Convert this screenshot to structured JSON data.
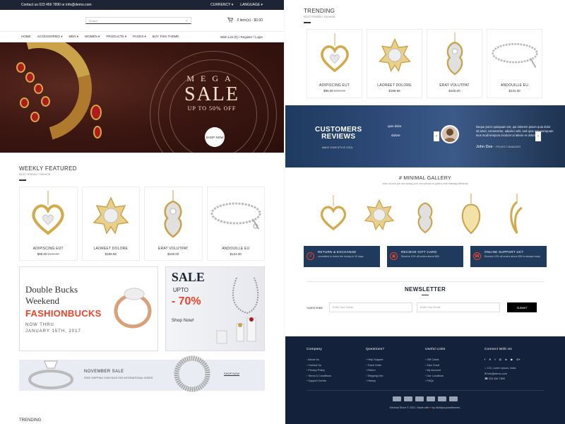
{
  "topbar": {
    "contact": "Contact us 023 456 7890 or info@demo.com",
    "currency": "CURRENCY",
    "language": "LANGUAGE"
  },
  "header": {
    "search_placeholder": "Search",
    "cart": "0 item(s) - $0.00"
  },
  "nav": {
    "items": [
      "HOME",
      "ACCESSORIES ▾",
      "MEN ▾",
      "WOMEN ▾",
      "PRODUCTS ▾",
      "PAGES ▾",
      "BUY THIS THEME"
    ],
    "right": "Wish List (0) / Register / Login"
  },
  "hero": {
    "mega": "MEGA",
    "sale": "SALE",
    "upto": "UP TO 50% OFF",
    "shop_now": "SHOP NOW"
  },
  "weekly": {
    "title": "WEEKLY FEATURED",
    "subtitle": "MOST FRIENDLY FASHION",
    "products": [
      {
        "name": "ADIPISCING EUT",
        "price": "$90.00",
        "old": "$100.00"
      },
      {
        "name": "LAOREET DOLORE",
        "price": "$199.99",
        "old": ""
      },
      {
        "name": "ERAT VOLUTPAT",
        "price": "$100.00",
        "old": ""
      },
      {
        "name": "ANDOUILLE EU",
        "price": "$122.00",
        "old": ""
      }
    ]
  },
  "banner1": {
    "line1": "Double Bucks",
    "line2": "Weekend",
    "brand": "FASHIONBUCKS",
    "now": "NOW THRU",
    "date": "JANUARY 15TH, 2017"
  },
  "banner2": {
    "sale": "SALE",
    "upto": "UPTO",
    "pct": "- 70%",
    "shop": "Shop Now!"
  },
  "november": {
    "title": "NOVEMBER SALE",
    "desc": "FREE SHIPPING OVER $125 FOR INTERNATIONAL ORDER",
    "btn": "SHOP NOW"
  },
  "left_bottom": "TRENDING",
  "trending": {
    "title": "TRENDING",
    "subtitle": "MOST FRIENDLY FASHION",
    "products": [
      {
        "name": "ADIPISCING EUT",
        "price": "$90.00",
        "old": "$100.00"
      },
      {
        "name": "LAOREET DOLORE",
        "price": "$199.99",
        "old": ""
      },
      {
        "name": "ERAT VOLUTPAT",
        "price": "$100.00",
        "old": ""
      },
      {
        "name": "ANDOUILLE EU",
        "price": "$122.00",
        "old": ""
      }
    ]
  },
  "reviews": {
    "heading1": "CUSTOMERS",
    "heading2": "REVIEWS",
    "sub": "MAKE YOUR STYLE COOL",
    "quote1": "quis dolor",
    "quote2": "dolore",
    "text": "Neque porro quisquam est, qui dolorem ipsum quia dolor sit amet, consectetur, adipisci velit, sed quia non numquam eius modi tempora incidunt ut labore et dolore.",
    "name": "John Doe",
    "role": "~ PROJECT MANAGER"
  },
  "gallery": {
    "title": "# MINIMAL GALLERY",
    "subtitle": "view us how you are styling your new pieces on gallery with hashtag #Minimal"
  },
  "features": [
    {
      "icon": "↺",
      "title": "RETURN & EXCHANGE",
      "desc": "committed to return the money in 30 days."
    },
    {
      "icon": "▣",
      "title": "RECIEVE GIFT CARD",
      "desc": "Receive 10% off orders above $50"
    },
    {
      "icon": "☎",
      "title": "ONLINE SUPPORT 24/7",
      "desc": "Receive 10% off orders above $50 to always ready"
    }
  ],
  "newsletter": {
    "title": "NEWSLETTER",
    "label": "SUBSCRIBE",
    "name_ph": "Enter Your Name",
    "email_ph": "Enter Your Email",
    "btn": "SUBMIT"
  },
  "footer": {
    "cols": [
      {
        "title": "Company",
        "items": [
          "About Us",
          "Contact Us",
          "Privacy Policy",
          "Terms & Conditions",
          "Support Centre"
        ]
      },
      {
        "title": "Questions?",
        "items": [
          "Help Support",
          "Track Order",
          "Return",
          "Shipping Info",
          "History"
        ]
      },
      {
        "title": "Useful Links",
        "items": [
          "Gift Cards",
          "Size Chart",
          "My Account",
          "Our Locations",
          "FAQs"
        ]
      },
      {
        "title": "Connect With Us",
        "items": [
          "123, Lorem Ipsum, India",
          "info@demo.com",
          "023 456 7890"
        ]
      }
    ],
    "social": [
      "f",
      "✕",
      "t",
      "◎",
      "in",
      "▶",
      "G+"
    ],
    "copyright": "Minimal Store © 2022. Made with",
    "by": "by Multipurposethemes."
  }
}
